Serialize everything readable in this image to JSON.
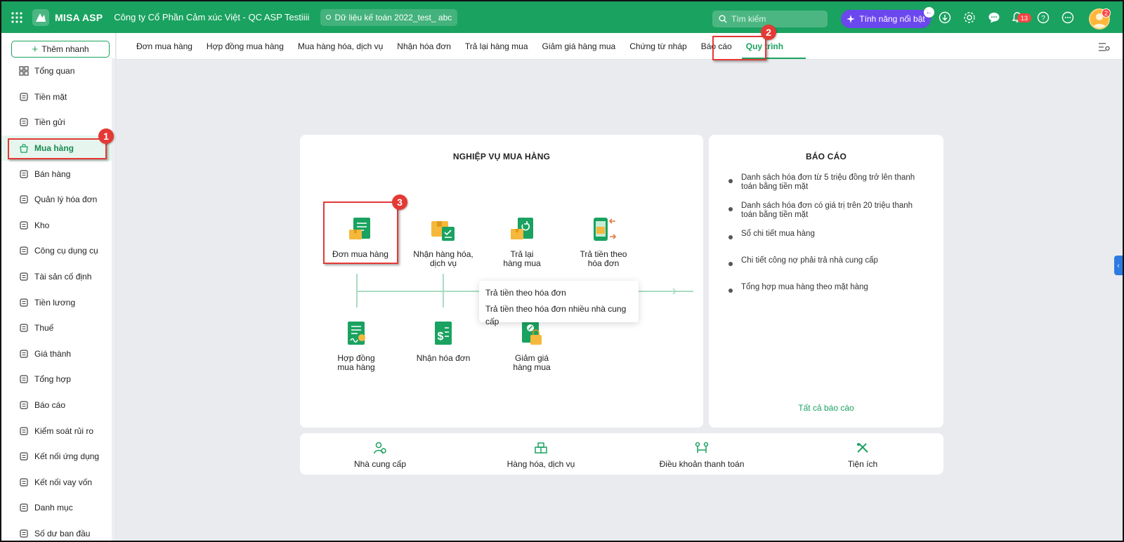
{
  "topbar": {
    "app_name": "MISA ASP",
    "company": "Công ty Cổ Phần Cảm xúc Việt - QC ASP Testiiii",
    "database": "Dữ liệu kế toán 2022_test_ abc",
    "search_placeholder": "Tìm kiếm",
    "feature_button": "Tính năng nổi bật",
    "notification_count": "13",
    "avatar_badge": "2"
  },
  "sidebar": {
    "quick_add": "Thêm nhanh",
    "items": [
      {
        "label": "Tổng quan",
        "icon": "dashboard-icon"
      },
      {
        "label": "Tiền mặt",
        "icon": "cash-icon"
      },
      {
        "label": "Tiền gửi",
        "icon": "bank-icon"
      },
      {
        "label": "Mua hàng",
        "icon": "shopping-bag-icon",
        "active": true
      },
      {
        "label": "Bán hàng",
        "icon": "cart-icon"
      },
      {
        "label": "Quản lý hóa đơn",
        "icon": "invoice-icon"
      },
      {
        "label": "Kho",
        "icon": "warehouse-icon"
      },
      {
        "label": "Công cụ dụng cụ",
        "icon": "tools-icon"
      },
      {
        "label": "Tài sản cố định",
        "icon": "truck-icon"
      },
      {
        "label": "Tiền lương",
        "icon": "salary-icon"
      },
      {
        "label": "Thuế",
        "icon": "tax-icon"
      },
      {
        "label": "Giá thành",
        "icon": "cost-icon"
      },
      {
        "label": "Tổng hợp",
        "icon": "summary-icon"
      },
      {
        "label": "Báo cáo",
        "icon": "report-icon"
      },
      {
        "label": "Kiểm soát rủi ro",
        "icon": "risk-icon"
      },
      {
        "label": "Kết nối ứng dụng",
        "icon": "rocket-icon"
      },
      {
        "label": "Kết nối vay vốn",
        "icon": "loan-icon"
      },
      {
        "label": "Danh mục",
        "icon": "list-icon"
      },
      {
        "label": "Số dư ban đầu",
        "icon": "balance-icon"
      }
    ]
  },
  "tabs": [
    "Đơn mua hàng",
    "Hợp đồng mua hàng",
    "Mua hàng hóa, dịch vụ",
    "Nhận hóa đơn",
    "Trả lại hàng mua",
    "Giảm giá hàng mua",
    "Chứng từ nháp",
    "Báo cáo",
    "Quy trình"
  ],
  "ops_panel": {
    "title": "NGHIỆP VỤ MUA HÀNG",
    "top_row": [
      {
        "line1": "Đơn mua hàng",
        "line2": "",
        "icon": "purchase-order-icon"
      },
      {
        "line1": "Nhận hàng hóa,",
        "line2": "dịch vụ",
        "icon": "receive-goods-icon"
      },
      {
        "line1": "Trả lại",
        "line2": "hàng mua",
        "icon": "return-goods-icon"
      },
      {
        "line1": "Trả tiền theo",
        "line2": "hóa đơn",
        "icon": "pay-invoice-icon"
      }
    ],
    "bottom_row": [
      {
        "line1": "Hợp đồng",
        "line2": "mua hàng",
        "icon": "contract-icon"
      },
      {
        "line1": "Nhận hóa đơn",
        "line2": "",
        "icon": "receive-invoice-icon"
      },
      {
        "line1": "Giảm giá",
        "line2": "hàng mua",
        "icon": "discount-icon"
      }
    ],
    "tooltip": [
      "Trả tiền theo hóa đơn",
      "Trả tiền theo hóa đơn nhiều nhà cung cấp"
    ]
  },
  "report_panel": {
    "title": "BÁO CÁO",
    "items": [
      {
        "line1": "Danh sách hóa đơn từ 5 triệu đồng trở lên thanh",
        "line2": "toán bằng tiền mặt"
      },
      {
        "line1": "Danh sách hóa đơn có giá trị trên 20 triệu thanh",
        "line2": "toán bằng tiền mặt"
      },
      {
        "line1": "Sổ chi tiết mua hàng",
        "line2": ""
      },
      {
        "line1": "Chi tiết công nợ phải trả nhà cung cấp",
        "line2": ""
      },
      {
        "line1": "Tổng hợp mua hàng theo mặt hàng",
        "line2": ""
      }
    ],
    "all_reports": "Tất cả báo cáo"
  },
  "utilities": [
    {
      "label": "Nhà cung cấp",
      "icon": "supplier-icon"
    },
    {
      "label": "Hàng hóa, dịch vụ",
      "icon": "goods-icon"
    },
    {
      "label": "Điều khoản thanh toán",
      "icon": "payment-terms-icon"
    },
    {
      "label": "Tiện ích",
      "icon": "utility-tools-icon"
    }
  ],
  "markers": [
    "1",
    "2",
    "3"
  ],
  "colors": {
    "brand_green": "#1aa260",
    "feature_purple": "#6b47ee",
    "annotation_red": "#e53935"
  }
}
